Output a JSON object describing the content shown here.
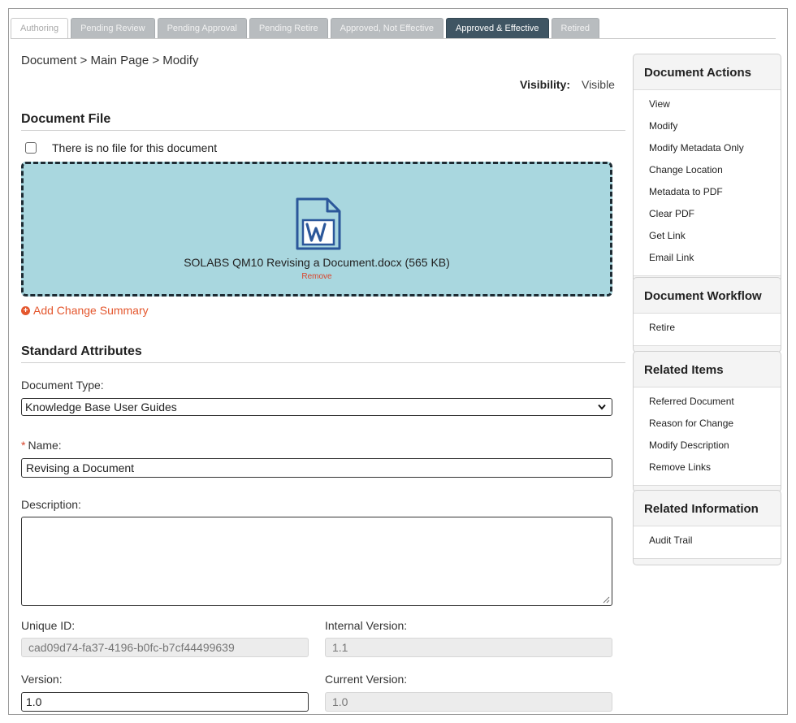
{
  "tabs": [
    {
      "label": "Authoring",
      "state": "inactive-light"
    },
    {
      "label": "Pending Review",
      "state": "inactive"
    },
    {
      "label": "Pending Approval",
      "state": "inactive"
    },
    {
      "label": "Pending Retire",
      "state": "inactive"
    },
    {
      "label": "Approved, Not Effective",
      "state": "inactive"
    },
    {
      "label": "Approved & Effective",
      "state": "active"
    },
    {
      "label": "Retired",
      "state": "inactive"
    }
  ],
  "breadcrumb": "Document > Main Page > Modify",
  "visibility": {
    "label": "Visibility:",
    "value": "Visible"
  },
  "document_file": {
    "title": "Document File",
    "no_file_label": "There is no file for this document",
    "no_file_checked": false,
    "file_icon": "word-document-icon",
    "file_name": "SOLABS QM10 Revising a Document.docx (565 KB)",
    "remove_label": "Remove",
    "add_change_summary": "Add Change Summary"
  },
  "standard_attributes": {
    "title": "Standard Attributes",
    "document_type_label": "Document Type:",
    "document_type_value": "Knowledge Base User Guides",
    "name_required_mark": "*",
    "name_label": "Name:",
    "name_value": "Revising a Document",
    "description_label": "Description:",
    "description_value": "",
    "unique_id_label": "Unique ID:",
    "unique_id_value": "cad09d74-fa37-4196-b0fc-b7cf44499639",
    "internal_version_label": "Internal Version:",
    "internal_version_value": "1.1",
    "version_label": "Version:",
    "version_value": "1.0",
    "current_version_label": "Current Version:",
    "current_version_value": "1.0"
  },
  "sidebar": {
    "document_actions": {
      "title": "Document Actions",
      "items": [
        "View",
        "Modify",
        "Modify Metadata Only",
        "Change Location",
        "Metadata to PDF",
        "Clear PDF",
        "Get Link",
        "Email Link"
      ]
    },
    "document_workflow": {
      "title": "Document Workflow",
      "items": [
        "Retire"
      ]
    },
    "related_items": {
      "title": "Related Items",
      "items": [
        "Referred Document",
        "Reason for Change",
        "Modify Description",
        "Remove Links"
      ]
    },
    "related_information": {
      "title": "Related Information",
      "items": [
        "Audit Trail"
      ]
    }
  },
  "colors": {
    "active_tab": "#3f5563",
    "inactive_tab": "#b8bcbf",
    "dropzone": "#a9d7df",
    "accent_orange": "#e4572e",
    "word_blue": "#2b579a"
  }
}
